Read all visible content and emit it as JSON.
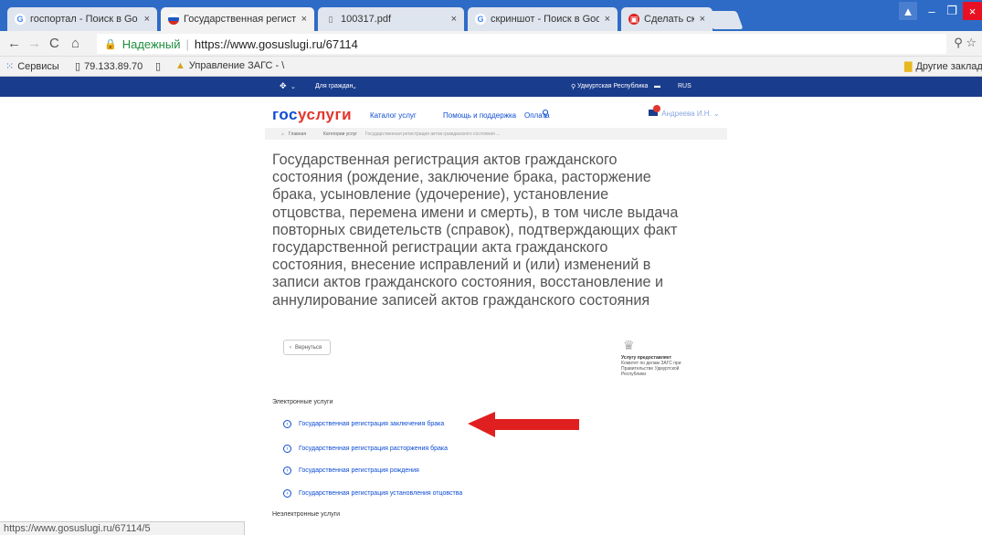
{
  "browser": {
    "tabs": [
      {
        "label": "госпортал - Поиск в Go",
        "icon": "google-icon"
      },
      {
        "label": "Государственная регист",
        "icon": "flag-icon"
      },
      {
        "label": "100317.pdf",
        "icon": "document-icon"
      },
      {
        "label": "скриншот - Поиск в Goo",
        "icon": "google-icon"
      },
      {
        "label": "Сделать скриншот — C",
        "icon": "screenshot-app-icon"
      }
    ],
    "close_glyph": "×",
    "address": {
      "secure_label": "Надежный",
      "url": "https://www.gosuslugi.ru/67114"
    },
    "bookmarks": [
      {
        "label": "Сервисы"
      },
      {
        "label": "79.133.89.70"
      },
      {
        "label": ""
      },
      {
        "label": "Управление ЗАГС - \\"
      }
    ],
    "other_bookmarks": "Другие закладк",
    "status_url": "https://www.gosuslugi.ru/67114/5"
  },
  "site": {
    "topbar": {
      "for_citizens": "Для граждан",
      "region": "Удмуртская Республика",
      "lang": "RUS"
    },
    "logo": {
      "part1": "гос",
      "part2": "услуги"
    },
    "nav": [
      "Каталог услуг",
      "Помощь и поддержка",
      "Оплата"
    ],
    "user": "Андреева И.Н.",
    "notifications": "15",
    "breadcrumbs": [
      "Главная",
      "Категории услуг",
      "Государственная регистрация актов гражданского состояния ..."
    ]
  },
  "page": {
    "title": "Государственная регистрация актов гражданского состояния (рождение, заключение брака, расторжение брака, усыновление (удочерение), установление отцовства, перемена имени и смерть), в том числе выдача повторных свидетельств (справок), подтверждающих факт государственной регистрации акта гражданского состояния, внесение исправлений и (или) изменений в записи актов гражданского состояния, восстановление и аннулирование записей актов гражданского состояния",
    "back": "Вернуться",
    "provider_heading": "Услугу предоставляет",
    "provider_name": "Комитет по делам ЗАГС при Правительстве Удмуртской Республики",
    "electronic_heading": "Электронные услуги",
    "electronic_services": [
      "Государственная регистрация заключения брака",
      "Государственная регистрация расторжения брака",
      "Государственная регистрация рождения",
      "Государственная регистрация установления отцовства"
    ],
    "nonelectronic_heading": "Неэлектронные услуги"
  },
  "colors": {
    "accent": "#0d4cd3",
    "brand_red": "#e2352c",
    "arrow": "#e02020",
    "top_bar": "#1a3c8c",
    "tab_bar": "#2e6bc6"
  }
}
